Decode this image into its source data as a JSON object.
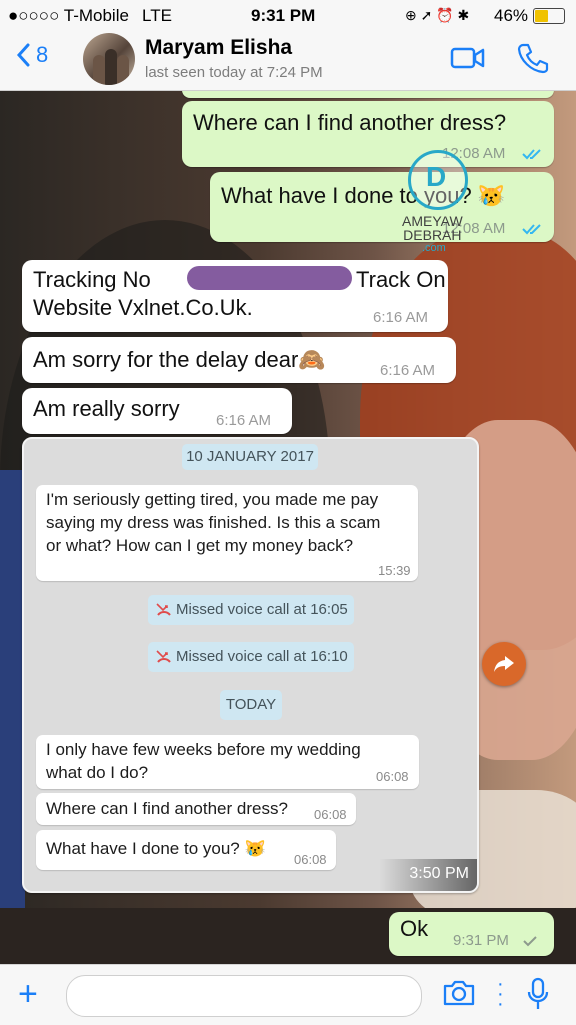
{
  "status_bar": {
    "carrier": "●○○○○ T-Mobile",
    "network": "LTE",
    "time": "9:31 PM",
    "battery": "46%"
  },
  "header": {
    "back_count": "8",
    "contact_name": "Maryam Elisha",
    "last_seen": "last seen today at 7:24 PM",
    "icons": [
      "chevron-left-icon",
      "video-call-icon",
      "phone-icon"
    ]
  },
  "messages": [
    {
      "direction": "out",
      "text": "Where can I find another dress?",
      "time": "12:08 AM",
      "status": "read"
    },
    {
      "direction": "out",
      "text": "What have I done to you? 😿",
      "time": "12:08 AM",
      "status": "read"
    },
    {
      "direction": "in",
      "text_line1_prefix": "Tracking No",
      "text_line1_suffix": "Track On",
      "text_line2": "Website Vxlnet.Co.Uk.",
      "time": "6:16 AM"
    },
    {
      "direction": "in",
      "text": "Am sorry for the delay dear🙈",
      "time": "6:16 AM"
    },
    {
      "direction": "in",
      "text": "Am really sorry",
      "time": "6:16 AM"
    },
    {
      "direction": "out",
      "text": "Ok",
      "time": "9:31 PM",
      "status": "delivered"
    }
  ],
  "watermark": {
    "line1": "AMEYAW",
    "line2": "DEBRAH",
    "line3": ".com"
  },
  "screenshot_card": {
    "date_chip_1": "10 JANUARY 2017",
    "msg1": {
      "lines": [
        "I'm seriously getting tired, you made me pay",
        "saying my dress was finished. Is this a scam",
        "or what? How can I get my money back?"
      ],
      "time": "15:39"
    },
    "missed_call_1": "Missed voice call at 16:05",
    "missed_call_2": "Missed voice call at 16:10",
    "date_chip_2": "TODAY",
    "msg2": {
      "lines": [
        "I only have few weeks before my wedding",
        "what do I do?"
      ],
      "time": "06:08"
    },
    "msg3": {
      "text": "Where can I find another dress?",
      "time": "06:08"
    },
    "msg4": {
      "text": "What have I done to you? 😿",
      "time": "06:08"
    },
    "card_time": "3:50 PM"
  },
  "composer": {
    "placeholder": "",
    "icons": [
      "plus-icon",
      "camera-icon",
      "mic-icon"
    ]
  },
  "colors": {
    "accent": "#1b7ff7",
    "outgoing_bubble": "#dcf8c6",
    "incoming_bubble": "#ffffff",
    "read_tick": "#34b7f1"
  }
}
